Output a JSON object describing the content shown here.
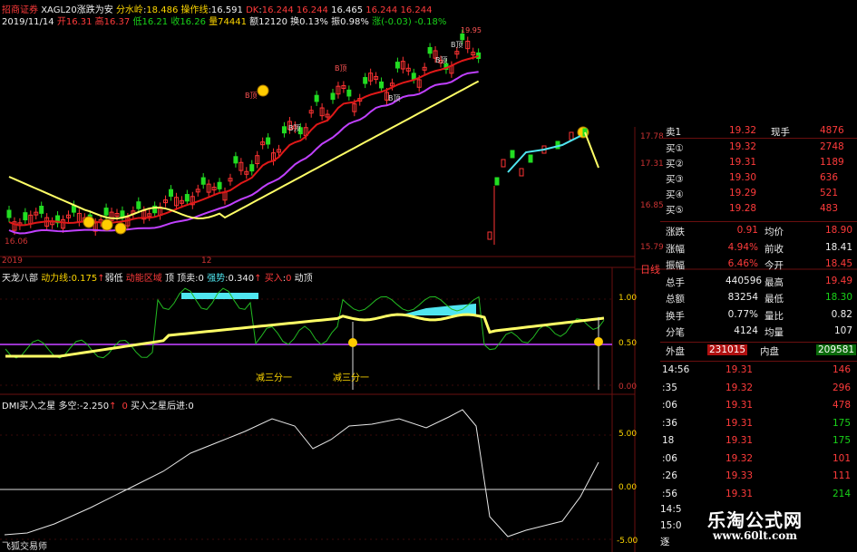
{
  "header": {
    "row1": {
      "stock": "招商证券",
      "fn": "XAGL20",
      "mode": "涨跌为安",
      "item2": "分水岭",
      "item2_val": "18.486",
      "item3": "操作线",
      "item3_val": "16.591",
      "item4": "DK",
      "item4_vals": [
        "16.244",
        "16.244",
        "16.465",
        "16.244",
        "16.244"
      ]
    },
    "row2": {
      "date": "2019/11/14",
      "open_label": "开",
      "open": "16.31",
      "high_label": "高",
      "high": "16.37",
      "low_label": "低",
      "low": "16.21",
      "close_label": "收",
      "close": "16.26",
      "vol_label": "量",
      "vol": "74441",
      "amt_label": "额",
      "amt": "12120",
      "turn_label": "换",
      "turn": "0.13%",
      "amp_label": "振",
      "amp": "0.98%",
      "chg_label": "涨",
      "chg": "(-0.03)",
      "chg_pct": "-0.18%"
    }
  },
  "price_axis": {
    "left_low": "16.06",
    "right": [
      "17.78",
      "17.31",
      "16.85",
      "15.79"
    ]
  },
  "candle_labels": [
    "B顶",
    "B顶",
    "B顶",
    "B顶",
    "B顶",
    "B顶"
  ],
  "peak_label": "19.95",
  "indicator1": {
    "date_left": "2019",
    "date_right": "12",
    "title": "天龙八部",
    "line1_label": "动力线",
    "line1_val": "0.175",
    "mode": "弱低",
    "item3": "动能区域",
    "item4": "顶",
    "item5": "顶卖",
    "item5_val": "0",
    "item6": "强势",
    "item6_val": "0.340",
    "item7": "买入",
    "item7_val": "0",
    "item8": "动顶",
    "annotations": [
      "减三分一",
      "减三分一"
    ],
    "axis": [
      "1.00",
      "0.50",
      "0.00"
    ],
    "fen": "日线"
  },
  "indicator2": {
    "title": "DMI买入之星",
    "item2": "多空",
    "item2_val": "-2.250",
    "item3": "买入之星后进",
    "item3_val": "0",
    "axis": [
      "5.00",
      "0.00",
      "-5.00"
    ],
    "footer": "飞狐交易师"
  },
  "order_book": {
    "sell_label": "卖1",
    "sell_price": "19.32",
    "sell_vol": "4876",
    "xian_shou": "现手",
    "bids": [
      {
        "label": "买①",
        "price": "19.32",
        "vol": "2748"
      },
      {
        "label": "买②",
        "price": "19.31",
        "vol": "1189"
      },
      {
        "label": "买③",
        "price": "19.30",
        "vol": "636"
      },
      {
        "label": "买④",
        "price": "19.29",
        "vol": "521"
      },
      {
        "label": "买⑤",
        "price": "19.28",
        "vol": "483"
      }
    ]
  },
  "quote": {
    "rows": [
      {
        "l1": "涨跌",
        "v1": "0.91",
        "l2": "均价",
        "v2": "18.90"
      },
      {
        "l1": "涨幅",
        "v1": "4.94%",
        "l2": "前收",
        "v2": "18.41"
      },
      {
        "l1": "振幅",
        "v1": "6.46%",
        "l2": "今开",
        "v2": "18.45"
      },
      {
        "l1": "总手",
        "v1": "440596",
        "l2": "最高",
        "v2": "19.49"
      },
      {
        "l1": "总额",
        "v1": "83254",
        "l2": "最低",
        "v2": "18.30"
      },
      {
        "l1": "换手",
        "v1": "0.77%",
        "l2": "量比",
        "v2": "0.82"
      },
      {
        "l1": "分笔",
        "v1": "4124",
        "l2": "均量",
        "v2": "107"
      }
    ],
    "outer_label": "外盘",
    "outer_val": "231015",
    "inner_label": "内盘",
    "inner_val": "209581"
  },
  "ticks": [
    {
      "time": "14:56",
      "price": "19.31",
      "vol": "146"
    },
    {
      "time": ":35",
      "price": "19.32",
      "vol": "296"
    },
    {
      "time": ":06",
      "price": "19.31",
      "vol": "478"
    },
    {
      "time": ":36",
      "price": "19.31",
      "vol": "175"
    },
    {
      "time": "18",
      "price": "19.31",
      "vol": "175"
    },
    {
      "time": ":06",
      "price": "19.32",
      "vol": "101"
    },
    {
      "time": ":26",
      "price": "19.33",
      "vol": "111"
    },
    {
      "time": ":56",
      "price": "19.31",
      "vol": "214"
    }
  ],
  "tick_footer": [
    "14:5",
    "15:0",
    "逐"
  ],
  "watermark": {
    "line1": "乐淘公式网",
    "line2": "www.60lt.com"
  },
  "colors": {
    "red_ma": "#e01818",
    "purple_ma": "#c040ff",
    "yellow_line": "#ffff66",
    "cyan_fill": "#4fe6f0",
    "grid": "#6a0f0f"
  }
}
